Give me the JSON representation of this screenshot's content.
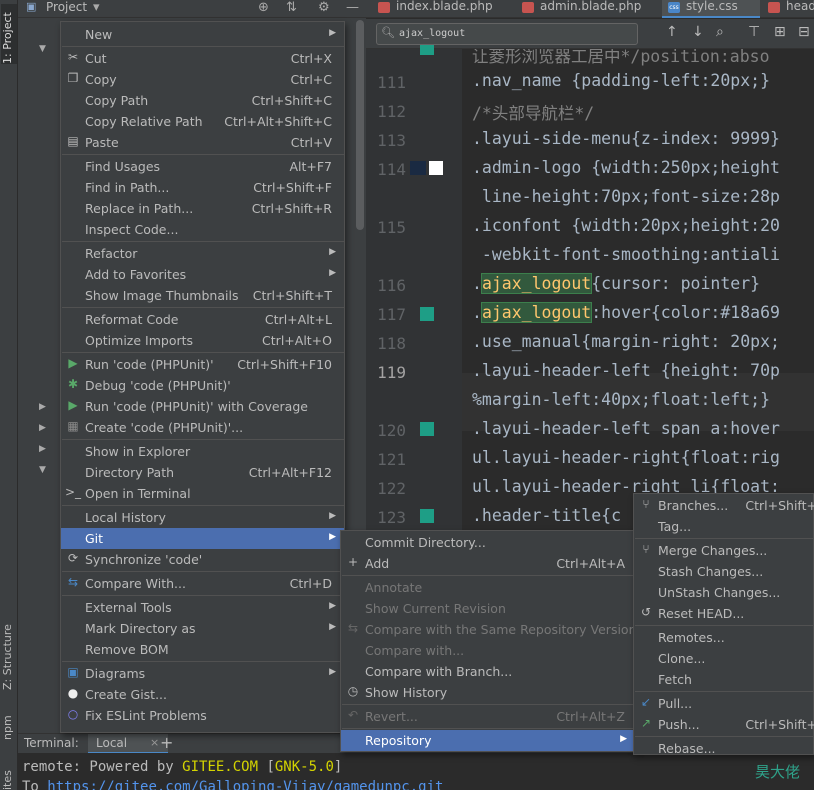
{
  "project_panel": {
    "title": "Project",
    "strip_tabs": {
      "project": "1: Project",
      "structure": "Z: Structure",
      "npm": "npm",
      "favorites": "ites"
    }
  },
  "editor_tabs": [
    {
      "label": "index.blade.php",
      "icon": "php-file-icon",
      "active": false
    },
    {
      "label": "admin.blade.php",
      "icon": "php-file-icon",
      "active": false
    },
    {
      "label": "style.css",
      "icon": "css-file-icon",
      "active": true
    },
    {
      "label": "head",
      "icon": "php-file-icon",
      "active": false
    }
  ],
  "search": {
    "value": "ajax_logout"
  },
  "gutter": {
    "line_numbers": [
      "111",
      "112",
      "113",
      "114",
      "115",
      "116",
      "117",
      "118",
      "119",
      "120",
      "121",
      "122",
      "123"
    ],
    "current_line": "119",
    "color_swatches": [
      "#1a2a42",
      "#ffffff"
    ]
  },
  "code": {
    "lines": [
      "让菱形浏览器工居中*/position:abso",
      ".nav_name {padding-left:20px;}",
      "/*头部导航栏*/",
      ".layui-side-menu{z-index: 9999}",
      ".admin-logo {width:250px;height",
      " line-height:70px;font-size:28p",
      ".iconfont {width:20px;height:20",
      " -webkit-font-smoothing:antiali",
      ".ajax_logout{cursor: pointer}",
      ".ajax_logout:hover{color:#18a69",
      ".use_manual{margin-right: 20px;",
      ".layui-header-left {height: 70p",
      "%margin-left:40px;float:left;}",
      ".layui-header-left span a:hover",
      "ul.layui-header-right{float:rig",
      "ul.layui-header-right li{float:",
      ".header-title{c"
    ]
  },
  "context_menu": {
    "items": [
      {
        "label": "New",
        "submenu": true
      },
      {
        "label": "Cut",
        "shortcut": "Ctrl+X",
        "icon": "scissors-icon"
      },
      {
        "label": "Copy",
        "shortcut": "Ctrl+C",
        "icon": "copy-icon"
      },
      {
        "label": "Copy Path",
        "shortcut": "Ctrl+Shift+C"
      },
      {
        "label": "Copy Relative Path",
        "shortcut": "Ctrl+Alt+Shift+C"
      },
      {
        "label": "Paste",
        "shortcut": "Ctrl+V",
        "icon": "paste-icon"
      },
      {
        "label": "Find Usages",
        "shortcut": "Alt+F7"
      },
      {
        "label": "Find in Path...",
        "shortcut": "Ctrl+Shift+F"
      },
      {
        "label": "Replace in Path...",
        "shortcut": "Ctrl+Shift+R"
      },
      {
        "label": "Inspect Code..."
      },
      {
        "label": "Refactor",
        "submenu": true
      },
      {
        "label": "Add to Favorites",
        "submenu": true
      },
      {
        "label": "Show Image Thumbnails",
        "shortcut": "Ctrl+Shift+T"
      },
      {
        "label": "Reformat Code",
        "shortcut": "Ctrl+Alt+L"
      },
      {
        "label": "Optimize Imports",
        "shortcut": "Ctrl+Alt+O"
      },
      {
        "label": "Run 'code (PHPUnit)'",
        "shortcut": "Ctrl+Shift+F10",
        "icon": "run-icon"
      },
      {
        "label": "Debug 'code (PHPUnit)'",
        "icon": "debug-icon"
      },
      {
        "label": "Run 'code (PHPUnit)' with Coverage",
        "icon": "coverage-icon"
      },
      {
        "label": "Create 'code (PHPUnit)'...",
        "icon": "phpunit-icon"
      },
      {
        "label": "Show in Explorer"
      },
      {
        "label": "Directory Path",
        "shortcut": "Ctrl+Alt+F12"
      },
      {
        "label": "Open in Terminal",
        "icon": "terminal-icon"
      },
      {
        "label": "Local History",
        "submenu": true
      },
      {
        "label": "Git",
        "submenu": true,
        "highlighted": true
      },
      {
        "label": "Synchronize 'code'",
        "icon": "sync-icon"
      },
      {
        "label": "Compare With...",
        "shortcut": "Ctrl+D",
        "icon": "compare-icon"
      },
      {
        "label": "External Tools",
        "submenu": true
      },
      {
        "label": "Mark Directory as",
        "submenu": true
      },
      {
        "label": "Remove BOM"
      },
      {
        "label": "Diagrams",
        "submenu": true,
        "icon": "diagram-icon"
      },
      {
        "label": "Create Gist...",
        "icon": "github-icon"
      },
      {
        "label": "Fix ESLint Problems",
        "icon": "eslint-icon"
      }
    ]
  },
  "git_menu": {
    "items": [
      {
        "label": "Commit Directory..."
      },
      {
        "label": "Add",
        "shortcut": "Ctrl+Alt+A",
        "icon": "plus-icon"
      },
      {
        "label": "Annotate",
        "disabled": true
      },
      {
        "label": "Show Current Revision",
        "disabled": true
      },
      {
        "label": "Compare with the Same Repository Version",
        "disabled": true,
        "icon": "compare-icon"
      },
      {
        "label": "Compare with...",
        "disabled": true
      },
      {
        "label": "Compare with Branch..."
      },
      {
        "label": "Show History",
        "icon": "clock-icon"
      },
      {
        "label": "Revert...",
        "shortcut": "Ctrl+Alt+Z",
        "disabled": true,
        "icon": "revert-icon"
      },
      {
        "label": "Repository",
        "submenu": true,
        "highlighted": true
      }
    ]
  },
  "repository_menu": {
    "items": [
      {
        "label": "Branches...",
        "shortcut": "Ctrl+Shift+",
        "icon": "branch-icon"
      },
      {
        "label": "Tag..."
      },
      {
        "label": "Merge Changes...",
        "icon": "merge-icon"
      },
      {
        "label": "Stash Changes..."
      },
      {
        "label": "UnStash Changes..."
      },
      {
        "label": "Reset HEAD...",
        "icon": "reset-icon"
      },
      {
        "label": "Remotes..."
      },
      {
        "label": "Clone..."
      },
      {
        "label": "Fetch"
      },
      {
        "label": "Pull...",
        "icon": "pull-icon"
      },
      {
        "label": "Push...",
        "shortcut": "Ctrl+Shift+",
        "icon": "push-icon"
      },
      {
        "label": "Rebase..."
      }
    ]
  },
  "terminal": {
    "label": "Terminal:",
    "tab": "Local",
    "line1": {
      "prefix": "remote: Powered by ",
      "gitee": "GITEE.COM",
      "bracket_open": " [",
      "gnk": "GNK-5.0",
      "bracket_close": "]"
    },
    "line2": {
      "prefix": "To ",
      "url": "https://gitee.com/Galloping-Vijay/gamedunpc.git"
    }
  },
  "watermark": "昊大佬"
}
